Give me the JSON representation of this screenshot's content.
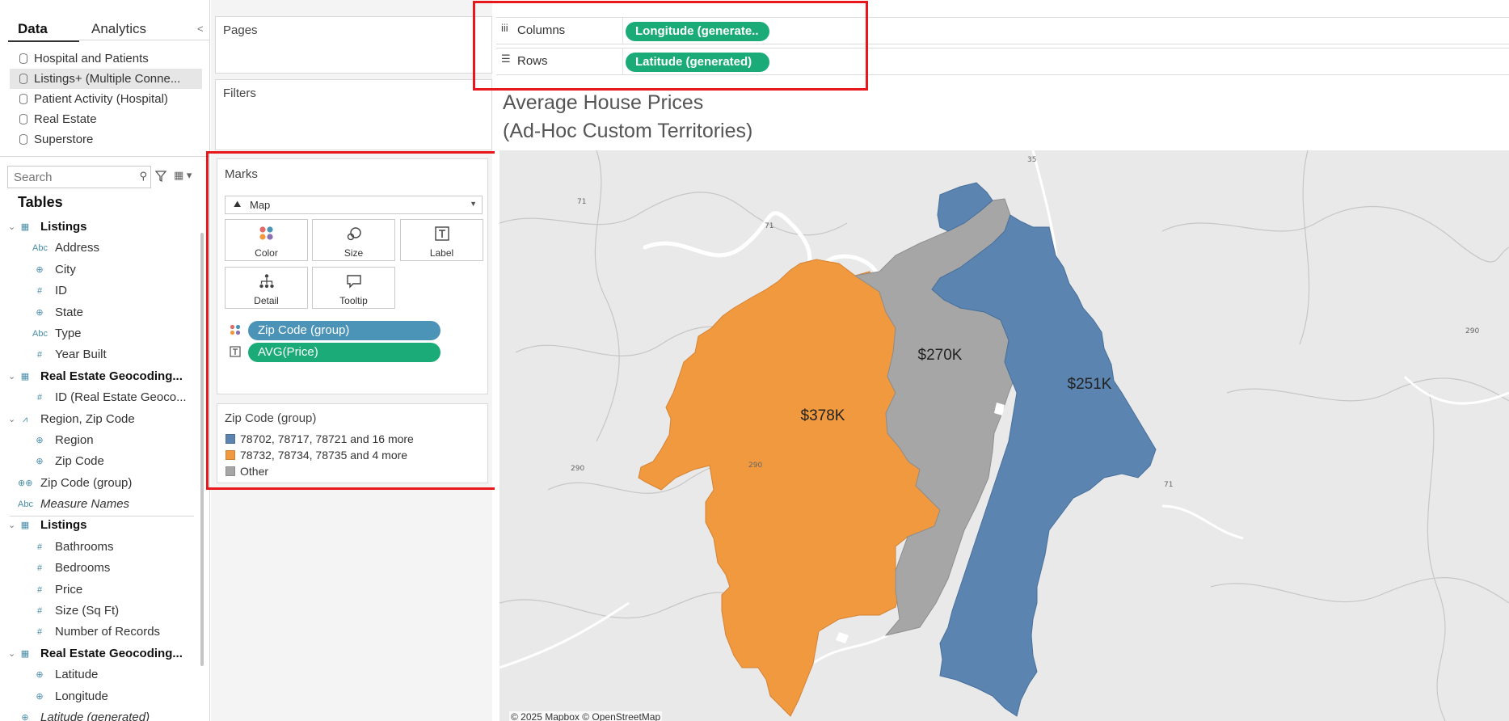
{
  "data_pane": {
    "tabs": [
      "Data",
      "Analytics"
    ],
    "collapse_glyph": "<",
    "data_sources": [
      {
        "label": "Hospital and Patients",
        "icon": "database-icon"
      },
      {
        "label": "Listings+ (Multiple Conne...",
        "icon": "database-icon"
      },
      {
        "label": "Patient Activity (Hospital)",
        "icon": "database-icon"
      },
      {
        "label": "Real Estate",
        "icon": "database-icon"
      },
      {
        "label": "Superstore",
        "icon": "database-icon"
      }
    ],
    "search_placeholder": "Search",
    "tables_heading": "Tables",
    "fields": [
      {
        "label": "Listings",
        "kind": "table",
        "icon": "▦",
        "level": 0
      },
      {
        "label": "Address",
        "kind": "field",
        "icon": "Abc",
        "level": 1
      },
      {
        "label": "City",
        "kind": "field",
        "icon": "⊕",
        "level": 1
      },
      {
        "label": "ID",
        "kind": "field",
        "icon": "#",
        "level": 1
      },
      {
        "label": "State",
        "kind": "field",
        "icon": "⊕",
        "level": 1
      },
      {
        "label": "Type",
        "kind": "field",
        "icon": "Abc",
        "level": 1
      },
      {
        "label": "Year Built",
        "kind": "field",
        "icon": "#",
        "level": 1
      },
      {
        "label": "Real Estate Geocoding...",
        "kind": "table",
        "icon": "▦",
        "level": 0
      },
      {
        "label": "ID (Real Estate Geoco...",
        "kind": "field",
        "icon": "#",
        "level": 1
      },
      {
        "label": "Region, Zip Code",
        "kind": "hierarchy",
        "icon": "⩘",
        "level": 0
      },
      {
        "label": "Region",
        "kind": "field",
        "icon": "⊕",
        "level": 1
      },
      {
        "label": "Zip Code",
        "kind": "field",
        "icon": "⊕",
        "level": 1
      },
      {
        "label": "Zip Code (group)",
        "kind": "group",
        "icon": "⊕⊕",
        "level": -1
      },
      {
        "label": "Measure Names",
        "kind": "italic",
        "icon": "Abc",
        "level": -1
      },
      {
        "label": "Listings",
        "kind": "table",
        "icon": "▦",
        "level": 0
      },
      {
        "label": "Bathrooms",
        "kind": "field",
        "icon": "#",
        "level": 1
      },
      {
        "label": "Bedrooms",
        "kind": "field",
        "icon": "#",
        "level": 1
      },
      {
        "label": "Price",
        "kind": "field",
        "icon": "#",
        "level": 1
      },
      {
        "label": "Size (Sq Ft)",
        "kind": "field",
        "icon": "#",
        "level": 1
      },
      {
        "label": "Number of Records",
        "kind": "field",
        "icon": "#",
        "level": 1
      },
      {
        "label": "Real Estate Geocoding...",
        "kind": "table",
        "icon": "▦",
        "level": 0
      },
      {
        "label": "Latitude",
        "kind": "field",
        "icon": "⊕",
        "level": 1
      },
      {
        "label": "Longitude",
        "kind": "field",
        "icon": "⊕",
        "level": 1
      },
      {
        "label": "Latitude (generated)",
        "kind": "italic",
        "icon": "⊕",
        "level": -1
      }
    ]
  },
  "shelves": {
    "pages_label": "Pages",
    "filters_label": "Filters",
    "columns_label": "Columns",
    "rows_label": "Rows",
    "columns_pill": "Longitude (generate..",
    "rows_pill": "Latitude (generated)"
  },
  "marks": {
    "title": "Marks",
    "mark_type": "Map",
    "buttons": [
      "Color",
      "Size",
      "Label",
      "Detail",
      "Tooltip"
    ],
    "pills": [
      "Zip Code (group)",
      "AVG(Price)"
    ]
  },
  "legend": {
    "title": "Zip Code (group)",
    "items": [
      {
        "label": "78702, 78717, 78721 and 16 more",
        "color": "#5b84b1"
      },
      {
        "label": "78732, 78734, 78735 and 4 more",
        "color": "#f0993f"
      },
      {
        "label": "Other",
        "color": "#a6a6a6"
      }
    ]
  },
  "view": {
    "title_line1": "Average House Prices",
    "title_line2": "(Ad-Hoc Custom Territories)",
    "map_labels": {
      "gray": "$270K",
      "blue": "$251K",
      "orange": "$378K"
    },
    "attribution": "© 2025 Mapbox © OpenStreetMap",
    "road_labels": [
      "71",
      "71",
      "290",
      "290",
      "290",
      "35",
      "71"
    ]
  },
  "colors": {
    "highlight": "#e8171c",
    "pill_blue": "#4b94b8",
    "pill_green": "#1aab78",
    "region_blue": "#5b84b1",
    "region_orange": "#f0993f",
    "region_gray": "#a6a6a6"
  }
}
